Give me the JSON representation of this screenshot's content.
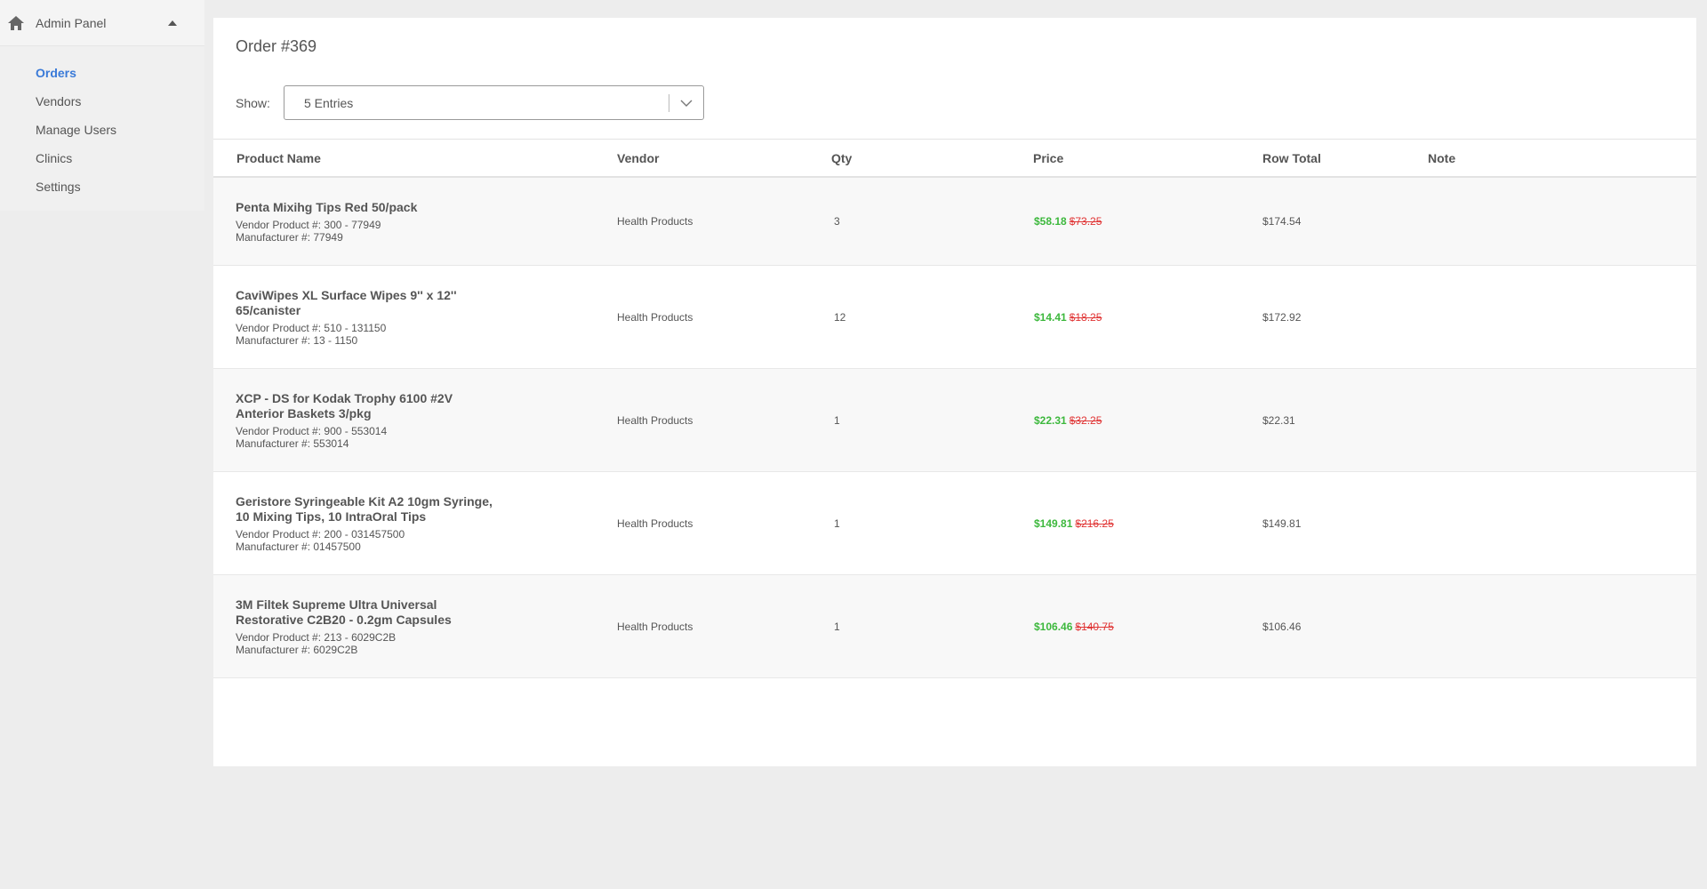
{
  "sidebar": {
    "header": {
      "title": "Admin Panel"
    },
    "items": [
      {
        "label": "Orders",
        "active": true
      },
      {
        "label": "Vendors",
        "active": false
      },
      {
        "label": "Manage Users",
        "active": false
      },
      {
        "label": "Clinics",
        "active": false
      },
      {
        "label": "Settings",
        "active": false
      }
    ]
  },
  "main": {
    "title": "Order #369",
    "show_label": "Show:",
    "entries_select": {
      "value": "5 Entries"
    },
    "columns": [
      "Product Name",
      "Vendor",
      "Qty",
      "Price",
      "Row Total",
      "Note"
    ],
    "rows": [
      {
        "name": "Penta Mixihg Tips Red 50/pack",
        "vendor_product": "Vendor Product #: 300 - 77949",
        "manufacturer": "Manufacturer #: 77949",
        "vendor": "Health Products",
        "qty": "3",
        "price_new": "$58.18",
        "price_old": "$73.25",
        "row_total": "$174.54",
        "note": ""
      },
      {
        "name": "CaviWipes XL Surface Wipes 9'' x 12'' 65/canister",
        "vendor_product": "Vendor Product #: 510 - 131150",
        "manufacturer": "Manufacturer #: 13 - 1150",
        "vendor": "Health Products",
        "qty": "12",
        "price_new": "$14.41",
        "price_old": "$18.25",
        "row_total": "$172.92",
        "note": ""
      },
      {
        "name": "XCP - DS for Kodak Trophy 6100 #2V Anterior Baskets 3/pkg",
        "vendor_product": "Vendor Product #: 900 - 553014",
        "manufacturer": "Manufacturer #: 553014",
        "vendor": "Health Products",
        "qty": "1",
        "price_new": "$22.31",
        "price_old": "$32.25",
        "row_total": "$22.31",
        "note": ""
      },
      {
        "name": "Geristore Syringeable Kit A2 10gm Syringe, 10 Mixing Tips, 10 IntraOral Tips",
        "vendor_product": "Vendor Product #: 200 - 031457500",
        "manufacturer": "Manufacturer #: 01457500",
        "vendor": "Health Products",
        "qty": "1",
        "price_new": "$149.81",
        "price_old": "$216.25",
        "row_total": "$149.81",
        "note": ""
      },
      {
        "name": "3M Filtek Supreme Ultra Universal Restorative C2B20 - 0.2gm Capsules",
        "vendor_product": "Vendor Product #: 213 - 6029C2B",
        "manufacturer": "Manufacturer #: 6029C2B",
        "vendor": "Health Products",
        "qty": "1",
        "price_new": "$106.46",
        "price_old": "$140.75",
        "row_total": "$106.46",
        "note": ""
      }
    ]
  },
  "colors": {
    "accent": "#3a7ad8",
    "price_new": "#3db83d",
    "price_old": "#e03434"
  },
  "icons": {
    "home": "home-icon",
    "caret": "caret-up-icon",
    "select_arrow": "chevron-down-icon"
  }
}
